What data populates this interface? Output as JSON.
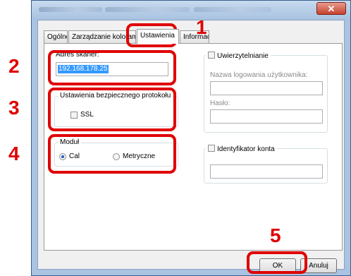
{
  "tabs": [
    {
      "label": "Ogólne"
    },
    {
      "label": "Zarządzanie kolorami"
    },
    {
      "label": "Ustawienia"
    },
    {
      "label": "Informacje"
    }
  ],
  "scanner": {
    "label": "Adres skaner:",
    "value": "192.168.178.25"
  },
  "protocol": {
    "group_title": "Ustawienia bezpiecznego protokołu",
    "ssl_label": "SSL",
    "ssl_checked": false
  },
  "module": {
    "group_title": "Moduł",
    "option_cal": "Cal",
    "option_metric": "Metryczne",
    "selected": "Cal"
  },
  "auth": {
    "checkbox_label": "Uwierzytelnianie",
    "checked": false,
    "username_label": "Nazwa logowania użytkownika:",
    "password_label": "Hasło:"
  },
  "account": {
    "checkbox_label": "Identyfikator konta",
    "checked": false
  },
  "buttons": {
    "ok": "OK",
    "cancel": "Anuluj"
  },
  "callouts": [
    "1",
    "2",
    "3",
    "4",
    "5"
  ],
  "colors": {
    "callout": "#e00000",
    "selection": "#3399ff"
  }
}
